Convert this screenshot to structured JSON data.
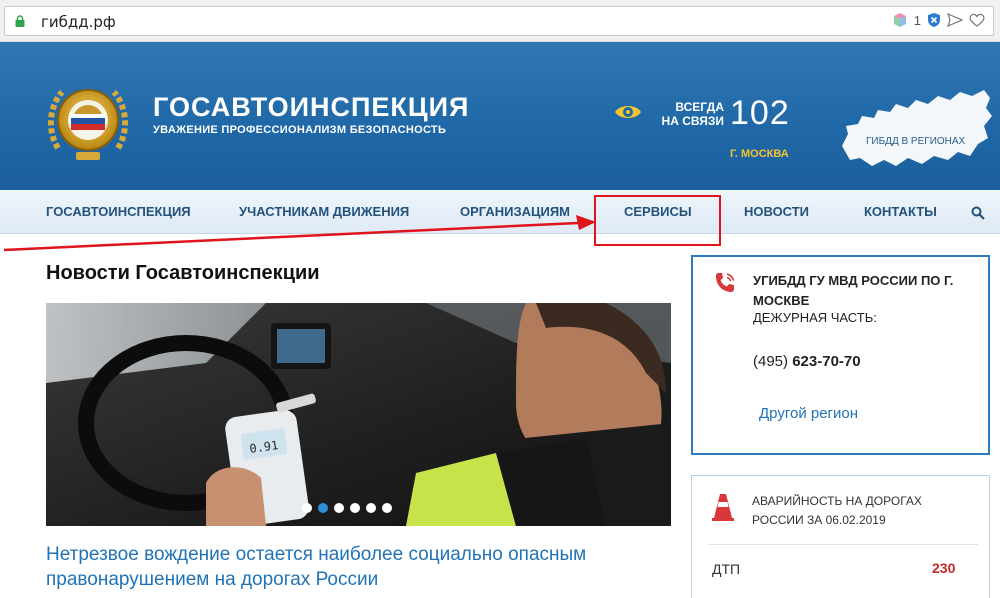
{
  "browser": {
    "url": "гибдд.рф",
    "badge_count": "1",
    "icons": [
      "lock-icon",
      "cube-icon",
      "shield-icon",
      "send-icon",
      "heart-icon"
    ]
  },
  "header": {
    "title": "ГОСАВТОИНСПЕКЦИЯ",
    "motto": "УВАЖЕНИЕ ПРОФЕССИОНАЛИЗМ БЕЗОПАСНОСТЬ",
    "hotline_label_1": "ВСЕГДА",
    "hotline_label_2": "НА СВЯЗИ",
    "hotline_number": "102",
    "city": "Г. МОСКВА",
    "regions_label": "ГИБДД В РЕГИОНАХ",
    "accent_color": "#f4c430",
    "header_color": "#1f67a6"
  },
  "nav": {
    "items": [
      "ГОСАВТОИНСПЕКЦИЯ",
      "УЧАСТНИКАМ ДВИЖЕНИЯ",
      "ОРГАНИЗАЦИЯМ",
      "СЕРВИСЫ",
      "НОВОСТИ",
      "КОНТАКТЫ"
    ],
    "highlighted": "СЕРВИСЫ",
    "highlight_color": "#e0141d"
  },
  "main": {
    "news_heading": "Новости Госавтоинспекции",
    "slider": {
      "device_reading": "0.91",
      "active_dot": 2,
      "dot_count": 6
    },
    "news_title": "Нетрезвое вождение остается наиболее социально опасным правонарушением на дорогах России"
  },
  "sidebar": {
    "dept_name": "УГИБДД ГУ МВД РОССИИ ПО Г. МОСКВЕ",
    "duty_label": "ДЕЖУРНАЯ ЧАСТЬ:",
    "phone_code": "(495)",
    "phone_number": "623-70-70",
    "other_region": "Другой регион",
    "accidents_title": "АВАРИЙНОСТЬ НА ДОРОГАХ РОССИИ ЗА 06.02.2019",
    "accidents_label": "ДТП",
    "accidents_value": "230"
  }
}
